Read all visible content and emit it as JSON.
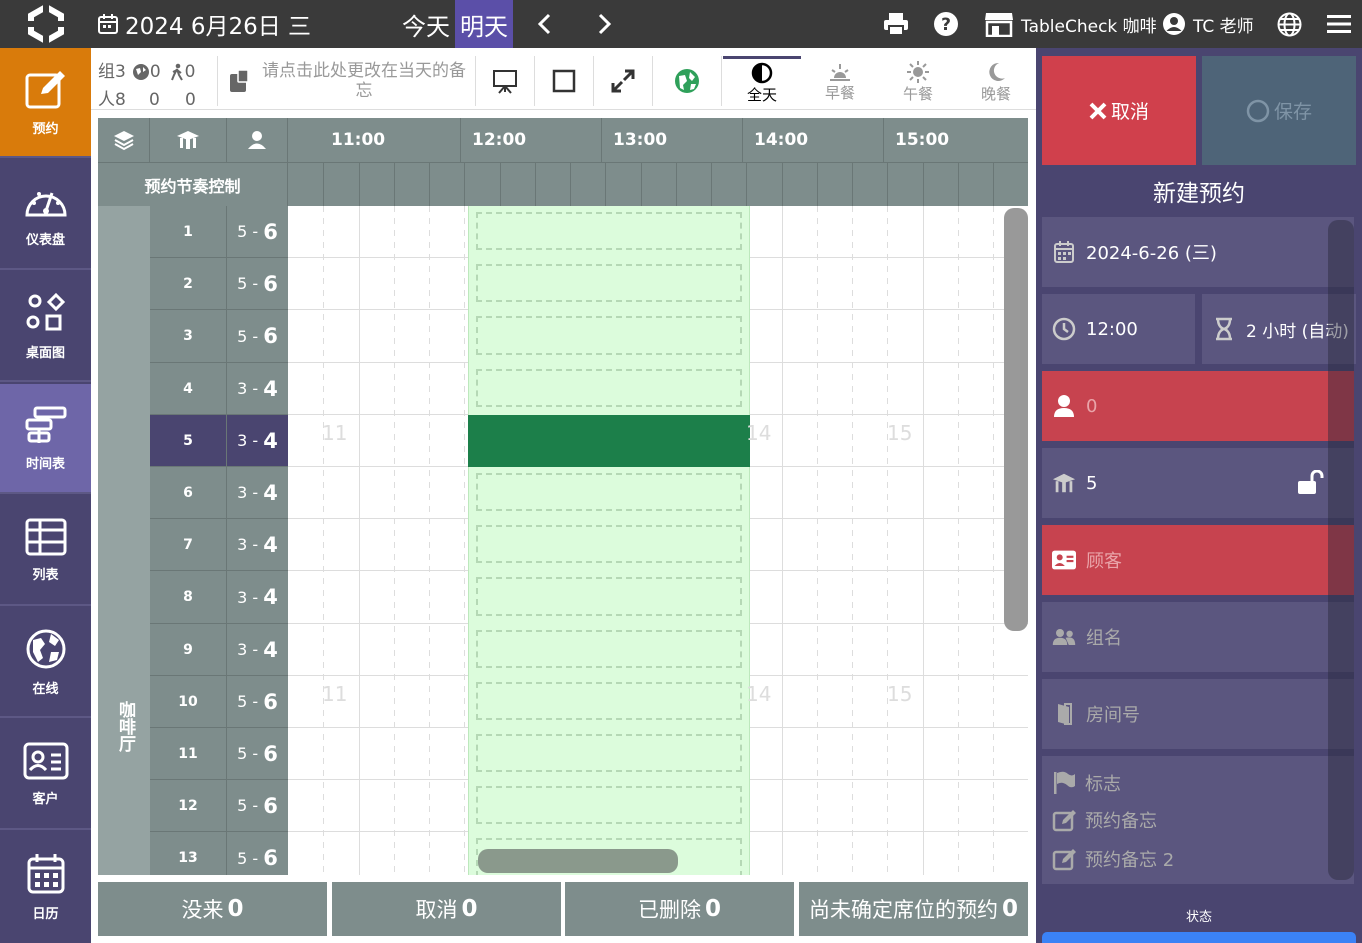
{
  "topbar": {
    "date_label": "2024 6月26日 三",
    "today": "今天",
    "tomorrow": "明天",
    "restaurant": "TableCheck 咖啡",
    "user": "TC 老师"
  },
  "nav": [
    {
      "label": "预约",
      "icon": "edit-icon"
    },
    {
      "label": "仪表盘",
      "icon": "dashboard-icon"
    },
    {
      "label": "桌面图",
      "icon": "floorplan-icon"
    },
    {
      "label": "时间表",
      "icon": "timeline-icon"
    },
    {
      "label": "列表",
      "icon": "table-icon"
    },
    {
      "label": "在线",
      "icon": "globe-icon"
    },
    {
      "label": "客户",
      "icon": "contact-card-icon"
    },
    {
      "label": "日历",
      "icon": "calendar-icon"
    }
  ],
  "stats": {
    "groups_label": "组",
    "groups": "3",
    "online": "0",
    "walkin": "0",
    "people_label": "人",
    "people": "8",
    "people_online": "0",
    "people_walkin": "0"
  },
  "memo_placeholder": "请点击此处更改在当天的备忘",
  "meals": [
    "全天",
    "早餐",
    "午餐",
    "晚餐"
  ],
  "grid": {
    "pacing_label": "预约节奏控制",
    "area_label": "咖啡厅",
    "hours": [
      "11:00",
      "12:00",
      "13:00",
      "14:00",
      "15:00"
    ],
    "ghost_numbers": [
      "11",
      "14",
      "15"
    ],
    "tables": [
      {
        "name": "1",
        "min": "5",
        "max": "6"
      },
      {
        "name": "2",
        "min": "5",
        "max": "6"
      },
      {
        "name": "3",
        "min": "5",
        "max": "6"
      },
      {
        "name": "4",
        "min": "3",
        "max": "4"
      },
      {
        "name": "5",
        "min": "3",
        "max": "4"
      },
      {
        "name": "6",
        "min": "3",
        "max": "4"
      },
      {
        "name": "7",
        "min": "3",
        "max": "4"
      },
      {
        "name": "8",
        "min": "3",
        "max": "4"
      },
      {
        "name": "9",
        "min": "3",
        "max": "4"
      },
      {
        "name": "10",
        "min": "5",
        "max": "6"
      },
      {
        "name": "11",
        "min": "5",
        "max": "6"
      },
      {
        "name": "12",
        "min": "5",
        "max": "6"
      },
      {
        "name": "13",
        "min": "5",
        "max": "6"
      }
    ]
  },
  "footer": [
    {
      "label": "没来",
      "count": "0"
    },
    {
      "label": "取消",
      "count": "0"
    },
    {
      "label": "已删除",
      "count": "0"
    },
    {
      "label": "尚未确定席位的预约",
      "count": "0"
    }
  ],
  "panel": {
    "cancel": "取消",
    "save": "保存",
    "title": "新建预约",
    "date": "2024-6-26 (三)",
    "time": "12:00",
    "duration": "2 小时 (自动)",
    "pax": "0",
    "table": "5",
    "customer": "顾客",
    "group": "组名",
    "room": "房间号",
    "tag": "标志",
    "memo": "预约备忘",
    "memo2": "预约备忘 2",
    "status": "状态"
  },
  "colors": {
    "nav_bg": "#4a4570",
    "nav_active": "#d97b0b",
    "selected_row": "#4a4570",
    "booking": "#1c7f4a",
    "slot": "#dcfcdc",
    "danger": "#c7434f"
  }
}
